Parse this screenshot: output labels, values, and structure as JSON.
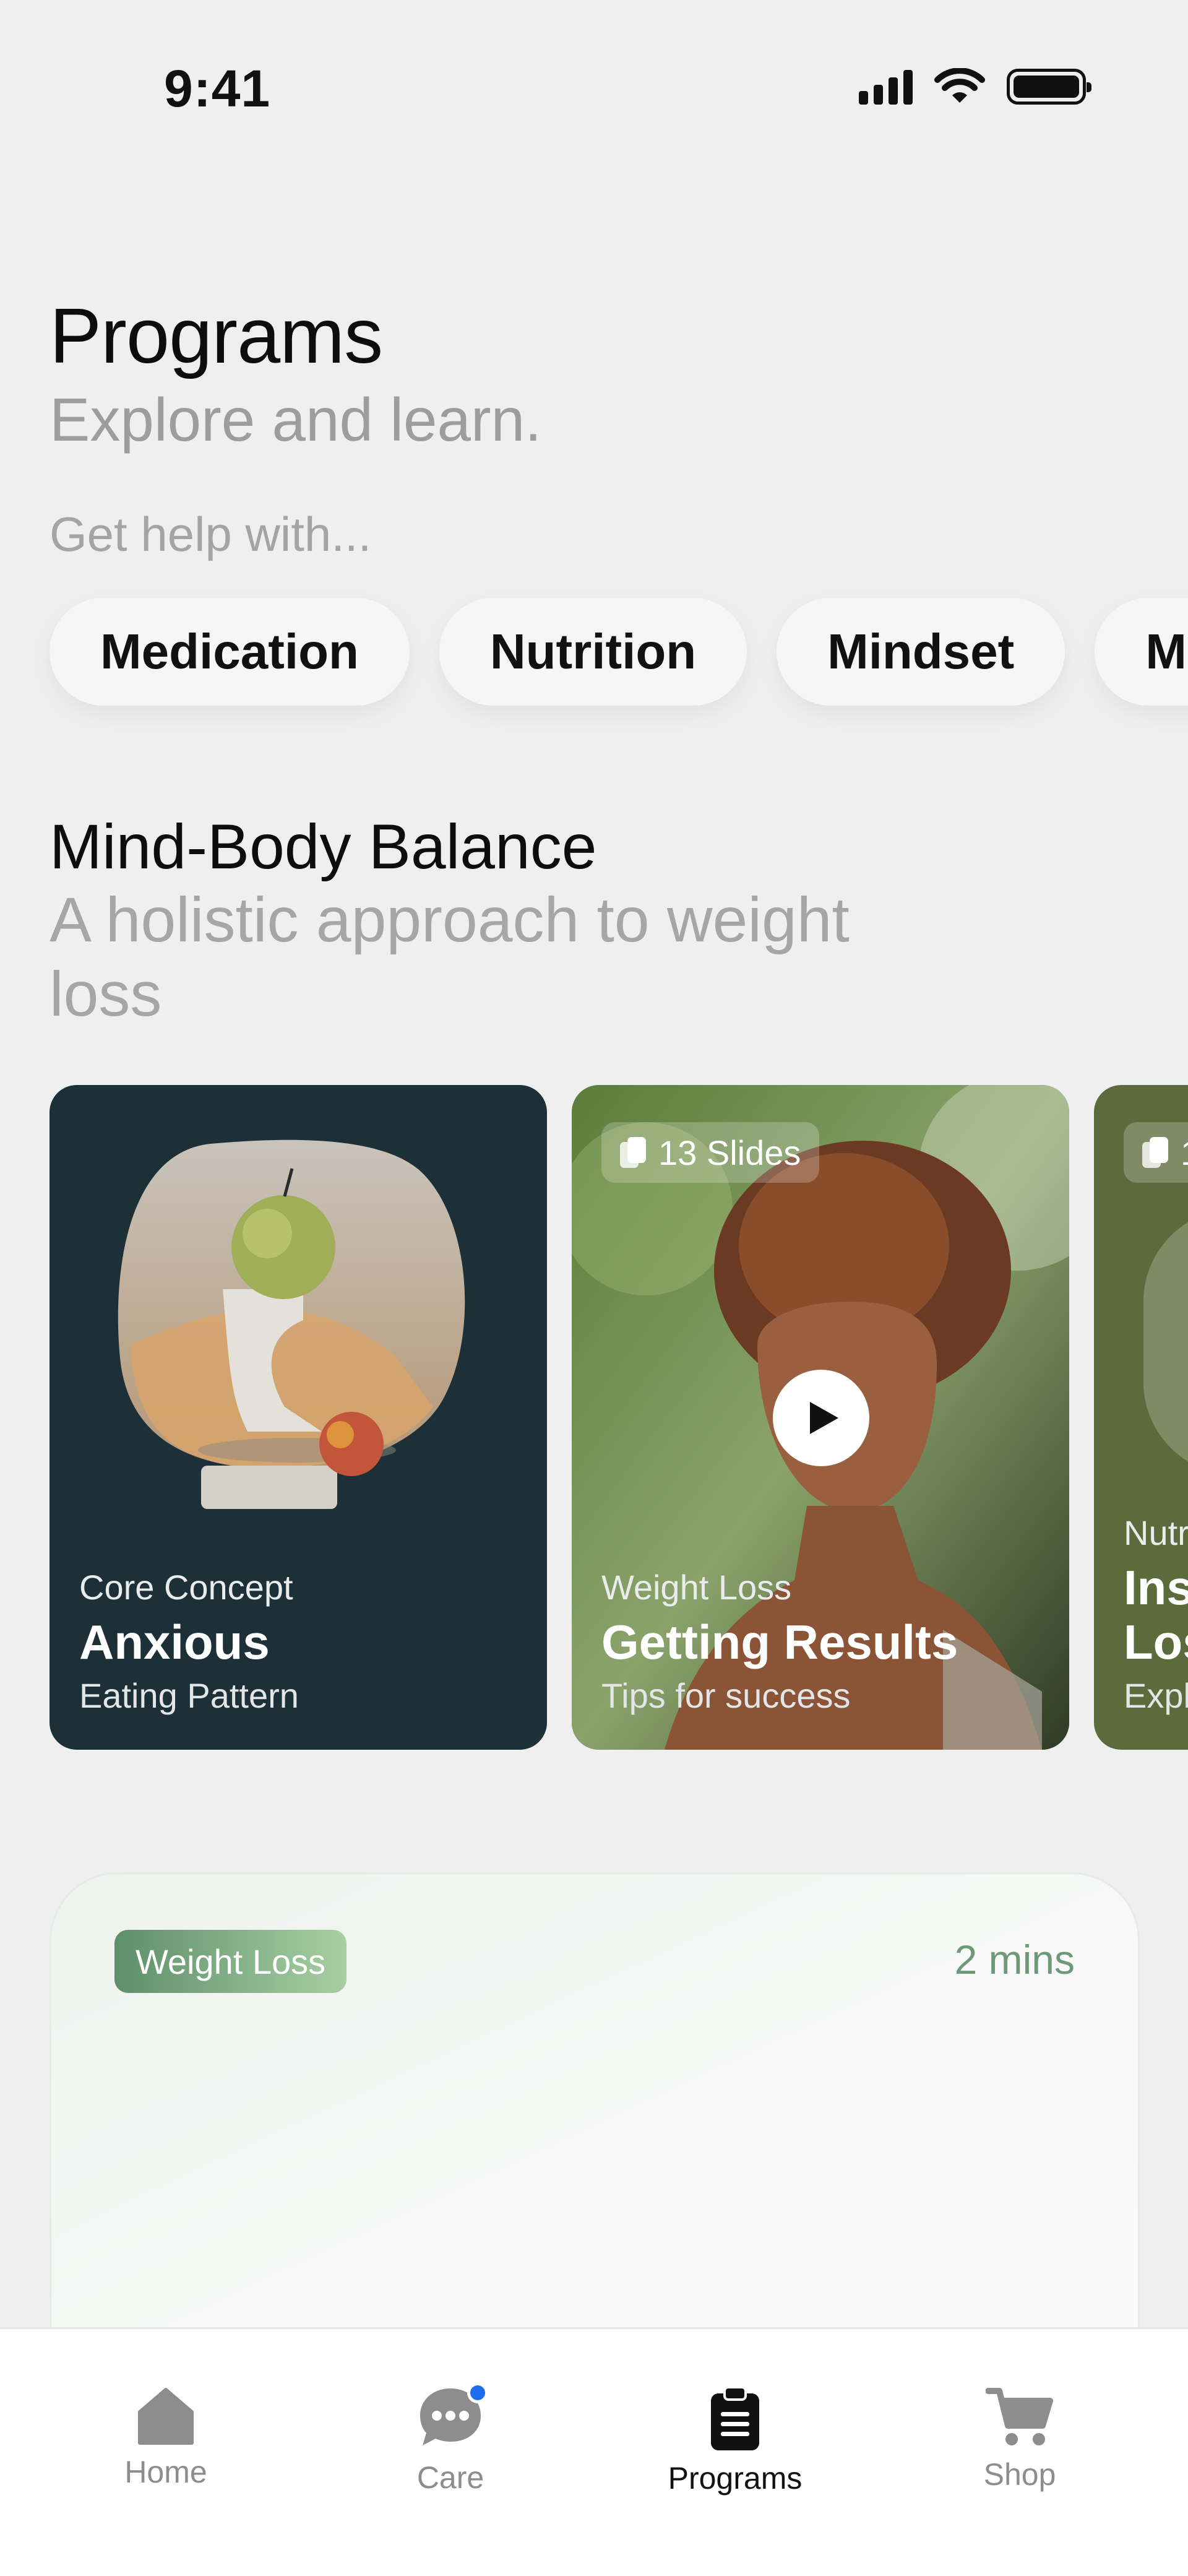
{
  "status_bar": {
    "time": "9:41"
  },
  "header": {
    "title": "Programs",
    "subtitle": "Explore and learn.",
    "help_label": "Get help with..."
  },
  "chips": [
    "Medication",
    "Nutrition",
    "Mindset",
    "Mo"
  ],
  "section": {
    "title": "Mind-Body Balance",
    "subtitle": "A holistic approach to weight loss"
  },
  "cards": [
    {
      "kicker": "Core Concept",
      "title": "Anxious",
      "subtitle": "Eating Pattern",
      "badge": ""
    },
    {
      "kicker": "Weight Loss",
      "title": "Getting Results",
      "subtitle": "Tips for success",
      "badge": "13 Slides"
    },
    {
      "kicker": "Nutr",
      "title": "Ins\nLos",
      "subtitle": "Expl",
      "badge": "1"
    }
  ],
  "article": {
    "tag": "Weight Loss",
    "duration": "2 mins"
  },
  "tabs": [
    {
      "label": "Home",
      "icon": "home-icon",
      "active": false
    },
    {
      "label": "Care",
      "icon": "chat-icon",
      "active": false
    },
    {
      "label": "Programs",
      "icon": "clipboard-icon",
      "active": true
    },
    {
      "label": "Shop",
      "icon": "cart-icon",
      "active": false
    }
  ],
  "colors": {
    "background": "#efefef",
    "accent_green": "#6f9876",
    "notification_dot": "#1e6df0",
    "card_dark": "#1d3037"
  }
}
